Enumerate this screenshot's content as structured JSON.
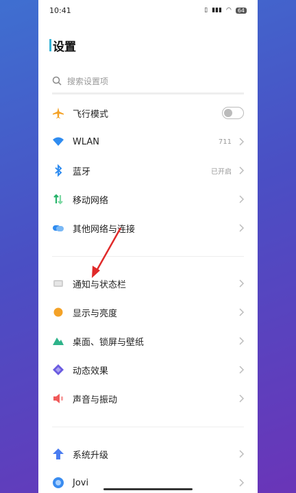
{
  "status": {
    "time": "10:41",
    "battery": "64"
  },
  "page": {
    "title": "设置"
  },
  "search": {
    "placeholder": "搜索设置项"
  },
  "group1": [
    {
      "label": "飞行模式",
      "value": "",
      "icon": "airplane-icon",
      "color": "#f4a227"
    },
    {
      "label": "WLAN",
      "value": "711",
      "icon": "wifi-icon",
      "color": "#2f8cf0"
    },
    {
      "label": "蓝牙",
      "value": "已开启",
      "icon": "bluetooth-icon",
      "color": "#2f8cf0"
    },
    {
      "label": "移动网络",
      "value": "",
      "icon": "mobile-data-icon",
      "color": "#26b36a"
    },
    {
      "label": "其他网络与连接",
      "value": "",
      "icon": "connection-icon",
      "color": "#2f8cf0"
    }
  ],
  "group2": [
    {
      "label": "通知与状态栏",
      "icon": "notification-icon",
      "color": "#c8c8c8"
    },
    {
      "label": "显示与亮度",
      "icon": "brightness-icon",
      "color": "#f4a227"
    },
    {
      "label": "桌面、锁屏与壁纸",
      "icon": "wallpaper-icon",
      "color": "#2eb38a"
    },
    {
      "label": "动态效果",
      "icon": "animation-icon",
      "color": "#6a5be0"
    },
    {
      "label": "声音与振动",
      "icon": "sound-icon",
      "color": "#f05a5a"
    }
  ],
  "group3": [
    {
      "label": "系统升级",
      "icon": "upgrade-icon",
      "color": "#4a7cf0"
    },
    {
      "label": "Jovi",
      "icon": "jovi-icon",
      "color": "#3a8cf0"
    }
  ]
}
